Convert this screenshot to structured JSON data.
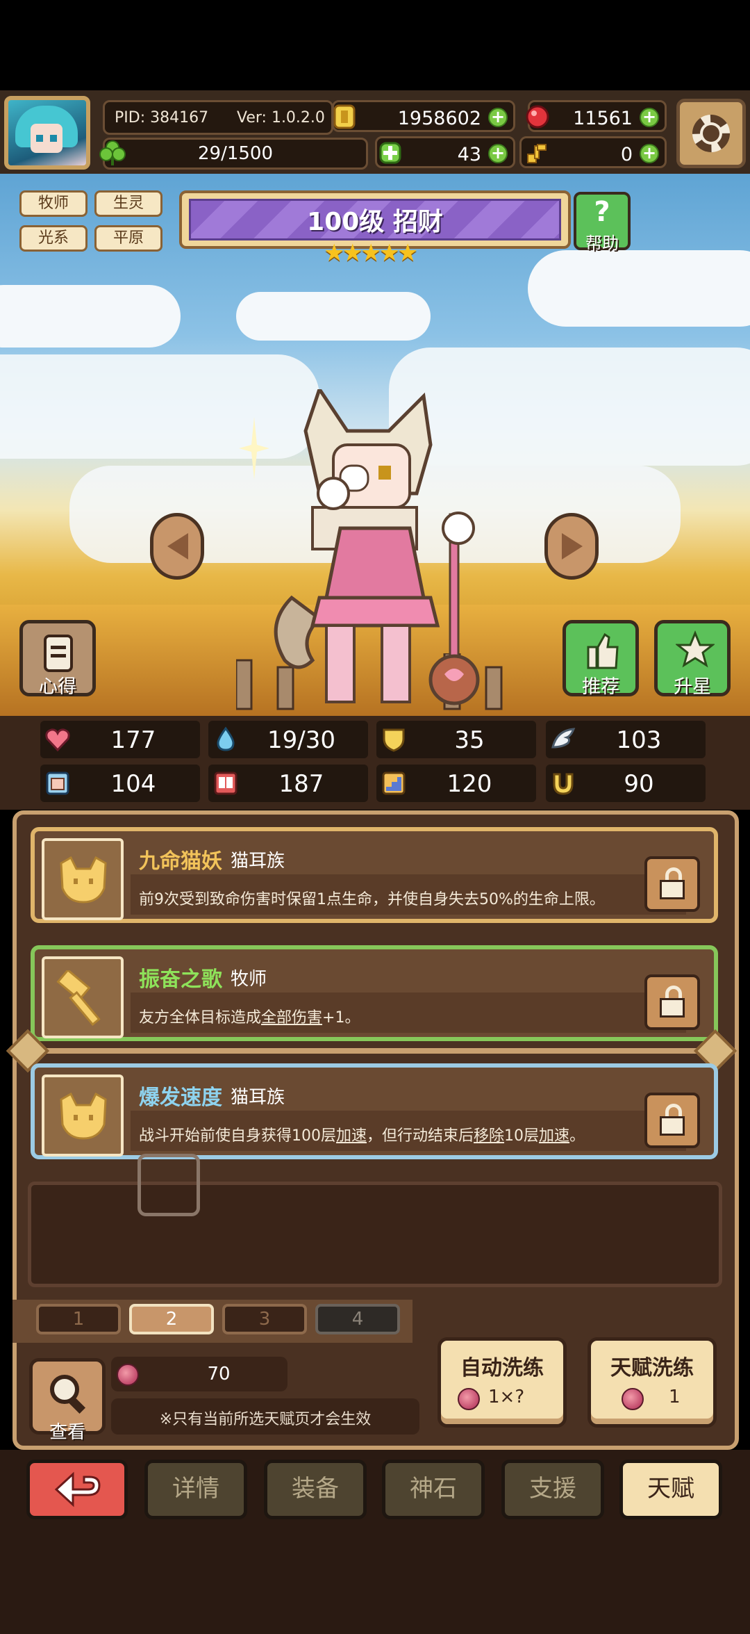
{
  "header": {
    "pid": "PID: 384167",
    "version": "Ver: 1.0.2.0",
    "exp": "29/1500",
    "gold": "1958602",
    "gems": "11561",
    "clover": "43",
    "key": "0"
  },
  "tags": [
    "牧师",
    "生灵",
    "光系",
    "平原"
  ],
  "banner": {
    "title": "100级 招财",
    "stars": 5,
    "help_label": "帮助",
    "help_glyph": "?"
  },
  "scene_buttons": {
    "left": "心得",
    "recommend": "推荐",
    "star_up": "升星"
  },
  "stats": [
    "177",
    "19/30",
    "35",
    "103",
    "104",
    "187",
    "120",
    "90"
  ],
  "talents": [
    {
      "name": "九命猫妖",
      "race": "猫耳族",
      "desc": "前9次受到致命伤害时保留1点生命，并使自身失去50%的生命上限。",
      "name_color": "#f2c35a",
      "border_color": "#e0b56a"
    },
    {
      "name": "振奋之歌",
      "race": "牧师",
      "desc_parts": [
        "友方全体目标造成",
        "全部伤害",
        "+1。"
      ],
      "name_color": "#8ee25a",
      "border_color": "#86c75a"
    },
    {
      "name": "爆发速度",
      "race": "猫耳族",
      "desc_parts": [
        "战斗开始前使自身获得100层",
        "加速",
        "，但行动结束后",
        "移除",
        "10层",
        "加速",
        "。"
      ],
      "name_color": "#8ed3ef",
      "border_color": "#9ccbe4"
    }
  ],
  "pages": [
    "1",
    "2",
    "3",
    "4"
  ],
  "bottom": {
    "view_label": "查看",
    "cost": "70",
    "note": "※只有当前所选天赋页才会生效",
    "auto_reroll": "自动洗练",
    "auto_cost": "1×?",
    "talent_reroll": "天赋洗练",
    "talent_cost": "1"
  },
  "nav": [
    "详情",
    "装备",
    "神石",
    "支援",
    "天赋"
  ]
}
